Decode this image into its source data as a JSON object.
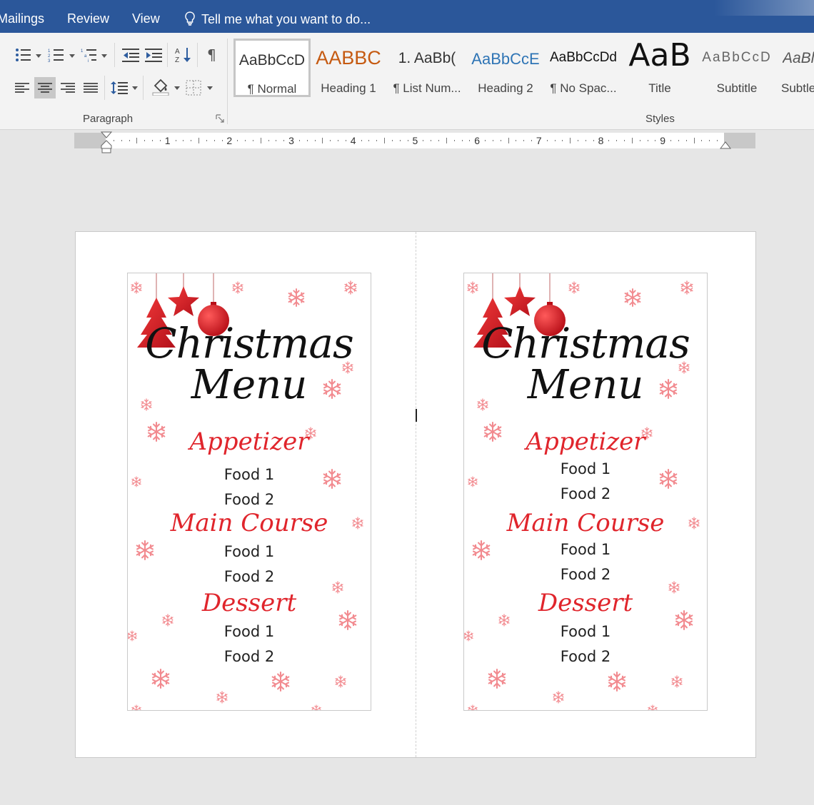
{
  "tabs": [
    "Mailings",
    "Review",
    "View"
  ],
  "tell_me": "Tell me what you want to do...",
  "ribbon": {
    "paragraph_label": "Paragraph",
    "styles_label": "Styles",
    "styles": [
      {
        "sample": "AaBbCcD",
        "name": "¶ Normal",
        "selected": true
      },
      {
        "sample": "AABBC",
        "name": "Heading 1"
      },
      {
        "sample": "1. AaBb(",
        "name": "¶ List Num..."
      },
      {
        "sample": "AaBbCcE",
        "name": "Heading 2"
      },
      {
        "sample": "AaBbCcDd",
        "name": "¶ No Spac..."
      },
      {
        "sample": "AaB",
        "name": "Title"
      },
      {
        "sample": "AaBbCcD",
        "name": "Subtitle"
      },
      {
        "sample": "AaBl",
        "name": "Subtle"
      }
    ]
  },
  "ruler": {
    "numbers": [
      "1",
      "2",
      "3",
      "4",
      "5",
      "6",
      "7",
      "8",
      "9"
    ]
  },
  "menu_cards": [
    {
      "title_line1": "Christmas",
      "title_line2": "Menu",
      "sections": [
        {
          "heading": "Appetizer",
          "items": [
            "Food 1",
            "Food 2"
          ]
        },
        {
          "heading": "Main Course",
          "items": [
            "Food 1",
            "Food 2"
          ]
        },
        {
          "heading": "Dessert",
          "items": [
            "Food 1",
            "Food 2"
          ]
        }
      ]
    },
    {
      "title_line1": "Christmas",
      "title_line2": "Menu",
      "sections": [
        {
          "heading": "Appetizer",
          "items": [
            "Food 1",
            "Food 2"
          ]
        },
        {
          "heading": "Main Course",
          "items": [
            "Food 1",
            "Food 2"
          ]
        },
        {
          "heading": "Dessert",
          "items": [
            "Food 1",
            "Food 2"
          ]
        }
      ]
    }
  ],
  "colors": {
    "accent": "#2b579a",
    "menu_red": "#e0252c"
  }
}
